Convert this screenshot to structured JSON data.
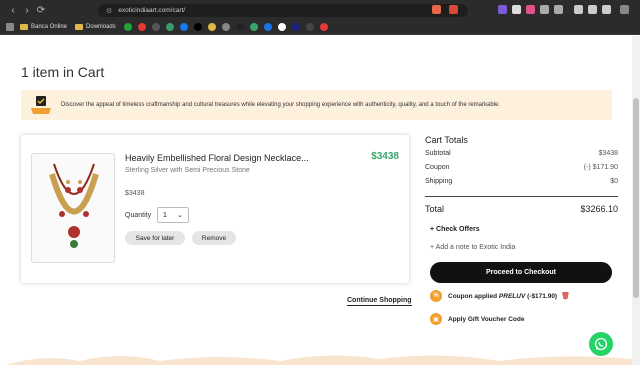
{
  "browser": {
    "url": "exoticindiaart.com/cart/",
    "nav": {
      "back": "‹",
      "forward": "›",
      "reload": "⟳"
    },
    "bookmarks": [
      {
        "label": "Banca Online"
      },
      {
        "label": "Downloads"
      }
    ],
    "bookmark_icon_colors": [
      "#21a336",
      "#e53935",
      "#555555",
      "#3a9b6a",
      "#1877f2",
      "#000000",
      "#e0b84a",
      "#888888",
      "#222222",
      "#3aa56a",
      "#1a73e8",
      "#ffffff",
      "#1a237e",
      "#444444",
      "#e53935"
    ]
  },
  "page": {
    "title": "1 item in Cart",
    "banner_text": "Discover the appeal of timeless craftmanship and cultural treasures while elevating your shopping experience with authenticity, quality, and a touch of the remarkable."
  },
  "cart_item": {
    "name": "Heavily Embellished Floral Design Necklace...",
    "subtitle": "Sterling Silver with Semi Precious Stone",
    "price": "$3438",
    "price_highlight": "$3438",
    "quantity_label": "Quantity",
    "quantity_value": "1",
    "save_label": "Save for later",
    "remove_label": "Remove"
  },
  "continue_shopping": "Continue Shopping",
  "totals": {
    "title": "Cart Totals",
    "subtotal_label": "Subtotal",
    "subtotal_value": "$3438",
    "coupon_label": "Coupon",
    "coupon_value": "(-) $171.90",
    "shipping_label": "Shipping",
    "shipping_value": "$0",
    "total_label": "Total",
    "total_value": "$3266.10",
    "check_offers": "Check Offers",
    "add_note": "Add a note to Exotic India",
    "checkout_label": "Proceed to Checkout",
    "coupon_applied_prefix": "Coupon applied",
    "coupon_code": "PRELUV",
    "coupon_discount": "(-$171.90)",
    "gift_voucher": "Apply Gift Voucher Code"
  },
  "colors": {
    "accent_green": "#3aa56a",
    "banner_bg": "#fdf0dc",
    "checkout_bg": "#111111",
    "orange": "#f0a030",
    "whatsapp": "#25d366"
  }
}
